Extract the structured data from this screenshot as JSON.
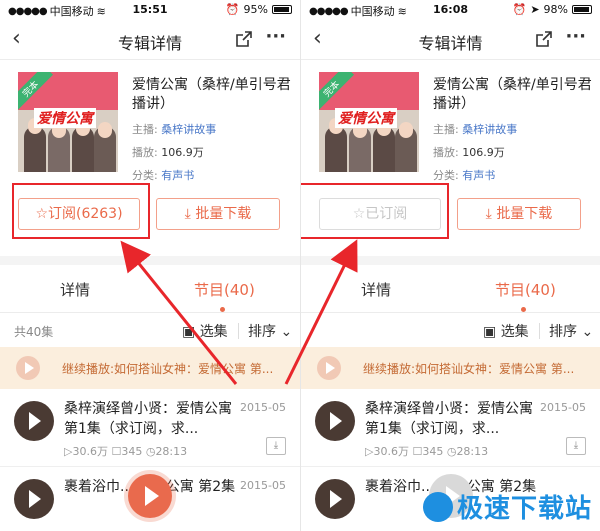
{
  "statusbars": [
    {
      "carrier": "中国移动",
      "time": "15:51",
      "battery": "95%"
    },
    {
      "carrier": "中国移动",
      "time": "16:08",
      "battery": "98%"
    }
  ],
  "navbar": {
    "title": "专辑详情",
    "back": "‹"
  },
  "album": {
    "title": "爱情公寓（桑梓/单引号君播讲）",
    "host_label": "主播:",
    "host": "桑梓讲故事",
    "plays_label": "播放:",
    "plays": "106.9万",
    "category_label": "分类:",
    "category": "有声书",
    "badge": "完本",
    "art_title": "爱情公寓"
  },
  "buttons": {
    "subscribe": "☆订阅(6263)",
    "subscribed": "☆已订阅",
    "download": "批量下载"
  },
  "tabs": {
    "detail": "详情",
    "episodes": "节目(40)"
  },
  "toolbar": {
    "count": "共40集",
    "select": "选集",
    "sort": "排序"
  },
  "resume": "继续播放:如何搭讪女神：爱情公寓 第...",
  "items": [
    {
      "title": "桑梓演绎曾小贤：爱情公寓 第1集（求订阅，求...",
      "date": "2015-05",
      "plays": "30.6万",
      "comments": "345",
      "duration": "28:13"
    },
    {
      "title": "裹着浴巾... 爱情公寓 第2集",
      "date": "2015-05"
    }
  ],
  "watermark": "极速下载站",
  "colors": {
    "accent": "#ea6a4a",
    "highlight": "#e8262b",
    "link": "#4a78c8"
  }
}
